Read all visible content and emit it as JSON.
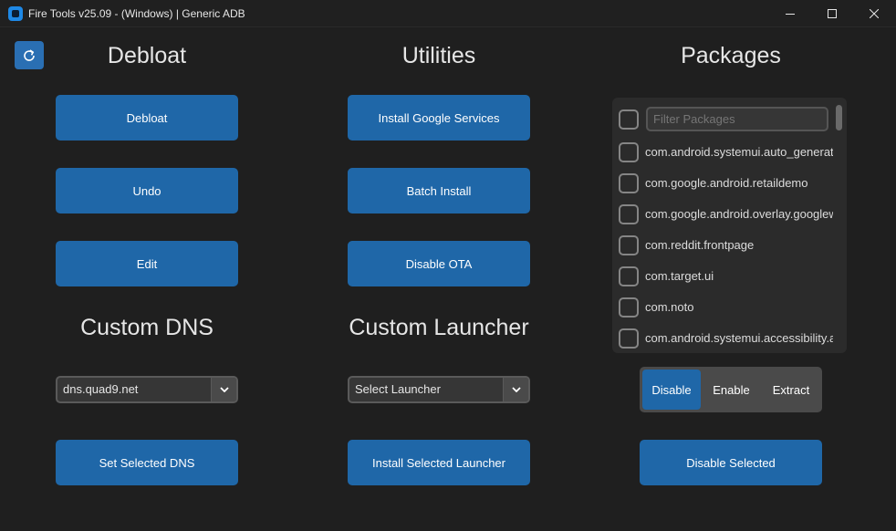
{
  "window": {
    "title": "Fire Tools v25.09 - (Windows) | Generic ADB"
  },
  "debloat": {
    "heading": "Debloat",
    "buttons": [
      "Debloat",
      "Undo",
      "Edit"
    ]
  },
  "utilities": {
    "heading": "Utilities",
    "buttons": [
      "Install Google Services",
      "Batch Install",
      "Disable OTA"
    ]
  },
  "packages": {
    "heading": "Packages",
    "filter_placeholder": "Filter Packages",
    "items": [
      "com.android.systemui.auto_generated_rro_vendor__",
      "com.google.android.retaildemo",
      "com.google.android.overlay.googlewebview",
      "com.reddit.frontpage",
      "com.target.ui",
      "com.noto",
      "com.android.systemui.accessibility.accessibilitymenu"
    ],
    "mode_options": [
      "Disable",
      "Enable",
      "Extract"
    ],
    "selected_mode": "Disable",
    "action_button": "Disable Selected"
  },
  "custom_dns": {
    "heading": "Custom DNS",
    "selected": "dns.quad9.net",
    "button": "Set Selected DNS"
  },
  "custom_launcher": {
    "heading": "Custom Launcher",
    "selected": "Select Launcher",
    "button": "Install Selected Launcher"
  },
  "colors": {
    "accent": "#1f67a8",
    "background": "#1f1f1f",
    "panel": "#2b2b2b"
  }
}
